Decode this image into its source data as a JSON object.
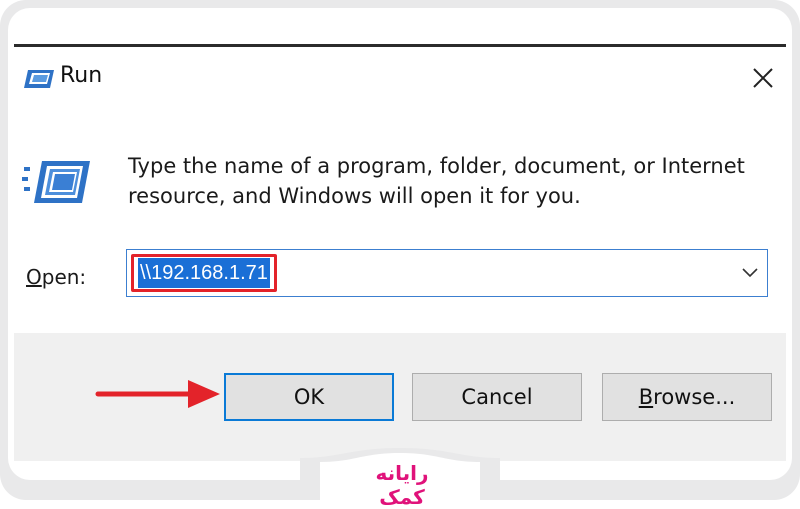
{
  "window": {
    "title": "Run",
    "close_icon": "close-icon"
  },
  "content": {
    "description": "Type the name of a program, folder, document, or Internet resource, and Windows will open it for you.",
    "open_label_first": "O",
    "open_label_rest": "pen:",
    "open_value": "\\\\192.168.1.71"
  },
  "buttons": {
    "ok": "OK",
    "cancel": "Cancel",
    "browse_first": "B",
    "browse_rest": "rowse..."
  },
  "watermark": {
    "logo_text": "رایانه کمک"
  },
  "colors": {
    "highlight_box": "#e3232a",
    "arrow": "#e3232a",
    "selection": "#1a6fd6",
    "focus_border": "#0a7ad6",
    "logo": "#e0127a"
  }
}
